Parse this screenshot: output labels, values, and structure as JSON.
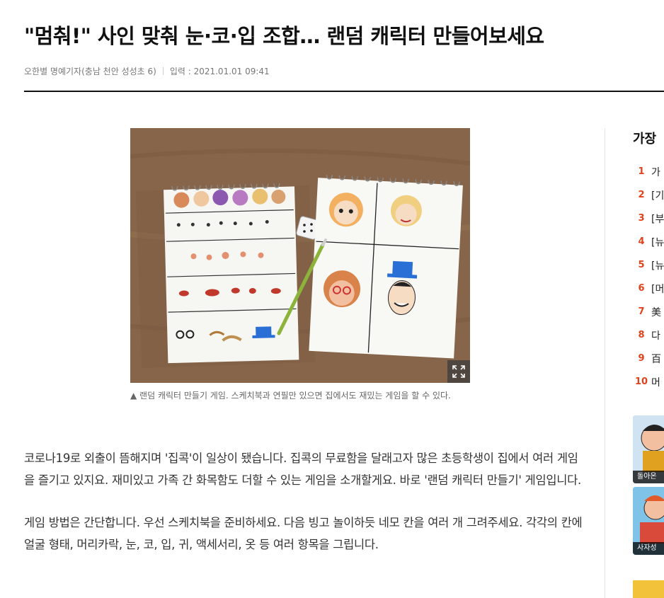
{
  "article": {
    "title": "\"멈춰!\" 사인 맞춰 눈·코·입 조합… 랜덤 캐릭터 만들어보세요",
    "author": "오한별 명예기자(충남 천안 성성초 6)",
    "date_label": "입력 : 2021.01.01  09:41",
    "photo_caption": "▲ 랜덤 캐릭터 만들기 게임. 스케치북과 연필만 있으면 집에서도 재밌는 게임을 할 수 있다.",
    "paragraphs": [
      "코로나19로 외출이 뜸해지며 '집콕'이 일상이 됐습니다. 집콕의 무료함을 달래고자 많은 초등학생이 집에서 여러 게임을 즐기고 있지요. 재미있고 가족 간 화목함도 더할 수 있는 게임을 소개할게요. 바로 '랜덤 캐릭터 만들기' 게임입니다.",
      "게임 방법은 간단합니다. 우선 스케치북을 준비하세요. 다음 빙고 놀이하듯 네모 칸을 여러 개 그려주세요. 각각의 칸에 얼굴 형태, 머리카락, 눈, 코, 입, 귀, 액세서리, 옷 등 여러 항목을 그립니다."
    ]
  },
  "sidebar": {
    "title": "가장",
    "ranking": [
      {
        "num": "1",
        "label": "가"
      },
      {
        "num": "2",
        "label": "[기"
      },
      {
        "num": "3",
        "label": "[부"
      },
      {
        "num": "4",
        "label": "[뉴"
      },
      {
        "num": "5",
        "label": "[뉴"
      },
      {
        "num": "6",
        "label": "[머"
      },
      {
        "num": "7",
        "label": "美"
      },
      {
        "num": "8",
        "label": "다"
      },
      {
        "num": "9",
        "label": "百"
      },
      {
        "num": "10",
        "label": "머"
      }
    ],
    "thumbs": [
      {
        "caption": "돌아온"
      },
      {
        "caption": "사자성"
      }
    ]
  },
  "colors": {
    "rank_number": "#e2421b",
    "headline": "#111111",
    "rule": "#111111"
  },
  "icons": {
    "expand": "expand-icon"
  }
}
